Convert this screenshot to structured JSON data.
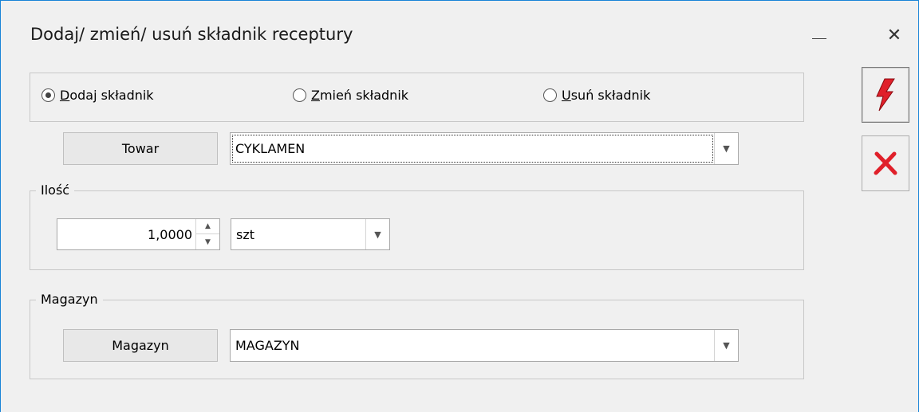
{
  "window": {
    "title": "Dodaj/ zmień/ usuń składnik receptury",
    "minimize_glyph": "—",
    "close_glyph": "✕"
  },
  "radio_group": {
    "options": [
      {
        "label": "Dodaj składnik",
        "hotkey": "D",
        "rest": "odaj składnik",
        "checked": true
      },
      {
        "label": "Zmień składnik",
        "hotkey": "Z",
        "rest": "mień składnik",
        "checked": false
      },
      {
        "label": "Usuń składnik",
        "hotkey": "U",
        "rest": "suń składnik",
        "checked": false
      }
    ]
  },
  "towar": {
    "button_label": "Towar",
    "value": "CYKLAMEN"
  },
  "ilosc": {
    "legend": "Ilość",
    "value": "1,0000",
    "unit": "szt"
  },
  "magazyn": {
    "legend": "Magazyn",
    "button_label": "Magazyn",
    "value": "MAGAZYN"
  },
  "side_buttons": {
    "save_icon": "lightning-icon",
    "cancel_icon": "x-icon"
  },
  "colors": {
    "accent_red": "#e0202a",
    "window_border": "#1883d7"
  }
}
